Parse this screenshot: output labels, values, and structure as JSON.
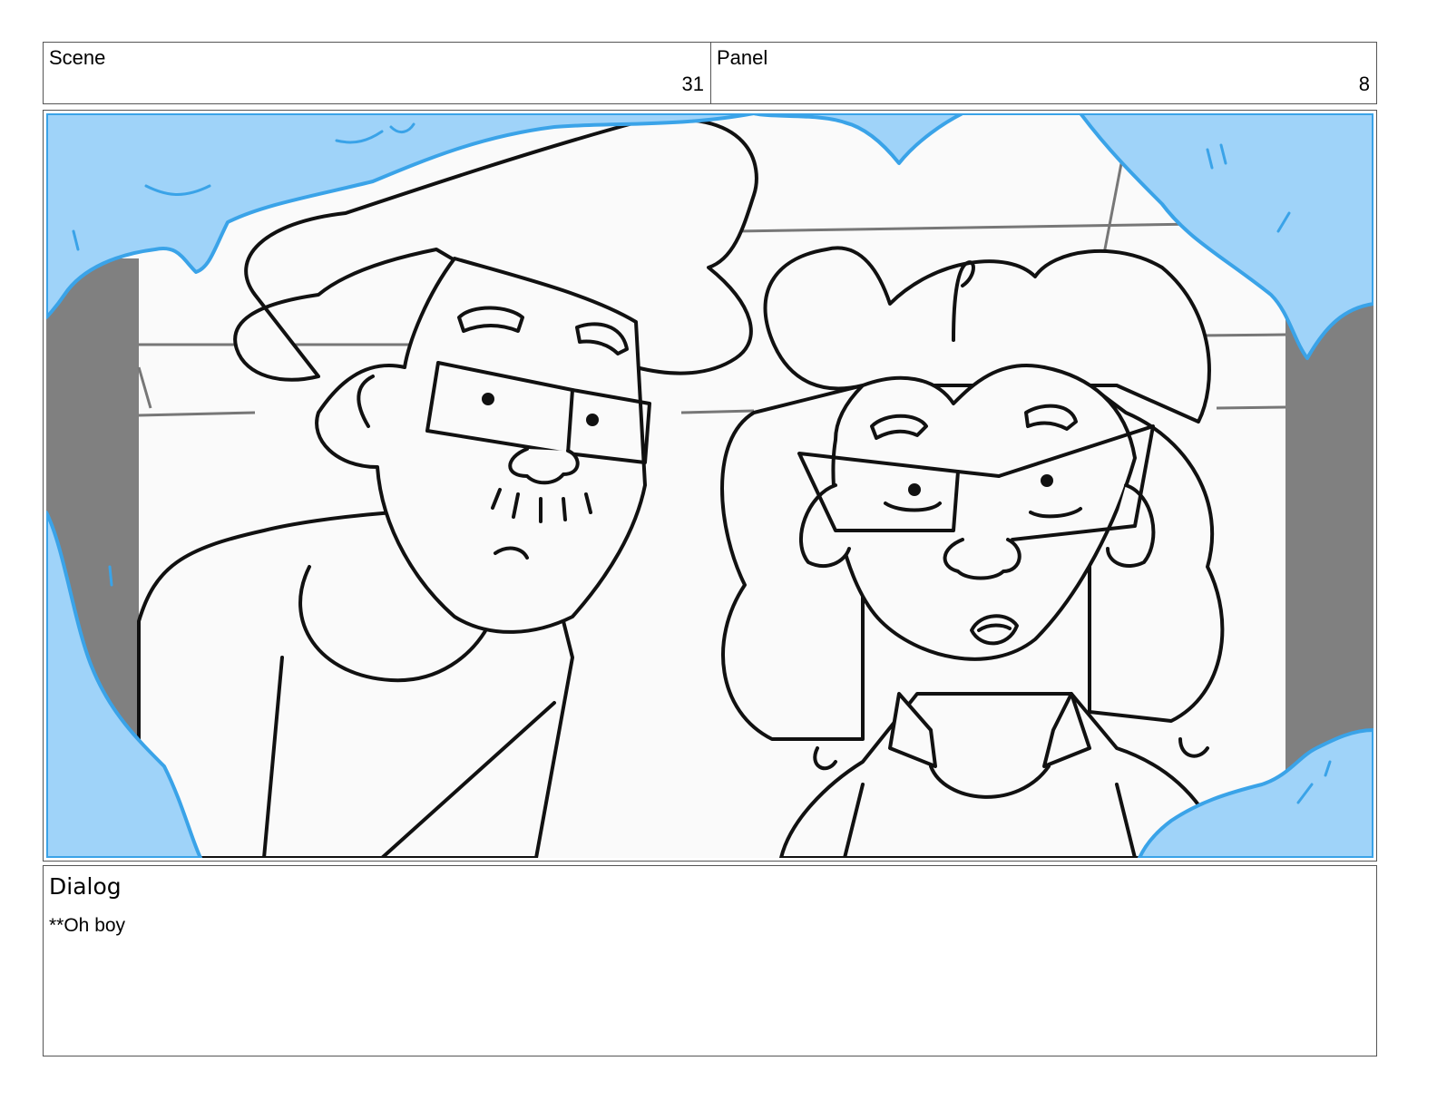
{
  "header": {
    "scene_label": "Scene",
    "scene_value": "31",
    "panel_label": "Panel",
    "panel_value": "8"
  },
  "panel_image": {
    "description_icon": "storyboard-sketch-two-characters",
    "colors": {
      "ice": "#9fd3f9",
      "ice_outline": "#3aa3e8",
      "wall": "#808080",
      "background": "#f9f9f9",
      "ink": "#111111"
    }
  },
  "dialog": {
    "title": "Dialog",
    "text": "**Oh boy"
  }
}
